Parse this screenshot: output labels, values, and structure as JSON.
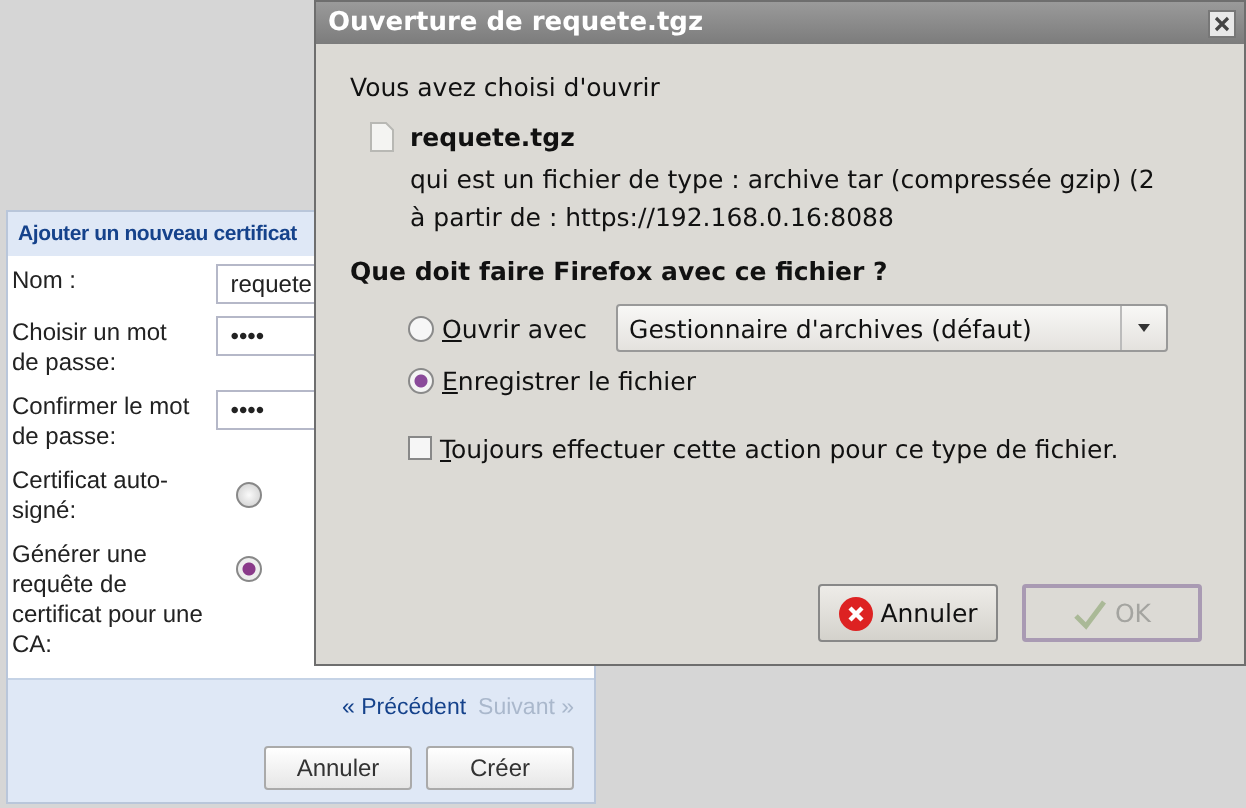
{
  "form": {
    "title": "Ajouter un nouveau certificat",
    "rows": [
      {
        "kind": "input",
        "label": "Nom :",
        "value": "requete"
      },
      {
        "kind": "password",
        "label": "Choisir un mot de passe:",
        "value": "••••"
      },
      {
        "kind": "password",
        "label": "Confirmer le mot de passe:",
        "value": "••••"
      },
      {
        "kind": "radio",
        "label": "Certificat auto-signé:",
        "selected": false
      },
      {
        "kind": "radio",
        "label": "Générer une requête de certificat pour une CA:",
        "selected": true
      }
    ],
    "nav": [
      {
        "label": "« Précédent",
        "disabled": false
      },
      {
        "label": "Suivant »",
        "disabled": true
      }
    ],
    "buttons": [
      "Annuler",
      "Créer"
    ]
  },
  "dialog": {
    "title": "Ouverture de requete.tgz",
    "intro": "Vous avez choisi d'ouvrir",
    "file_name": "requete.tgz",
    "file_type": "qui est un fichier de type :  archive tar (compressée gzip) (2",
    "source": "à partir de : https://192.168.0.16:8088",
    "question": "Que doit faire Firefox avec ce fichier ?",
    "options": [
      {
        "label": "Ouvrir avec",
        "selected": false,
        "app": "Gestionnaire d'archives (défaut)"
      },
      {
        "label": "Enregistrer le fichier",
        "selected": true
      }
    ],
    "always": {
      "label": "Toujours effectuer cette action pour ce type de fichier.",
      "checked": false
    },
    "buttons": [
      {
        "kind": "cancel",
        "label": "Annuler",
        "disabled": false
      },
      {
        "kind": "ok",
        "label": "OK",
        "disabled": true
      }
    ]
  }
}
